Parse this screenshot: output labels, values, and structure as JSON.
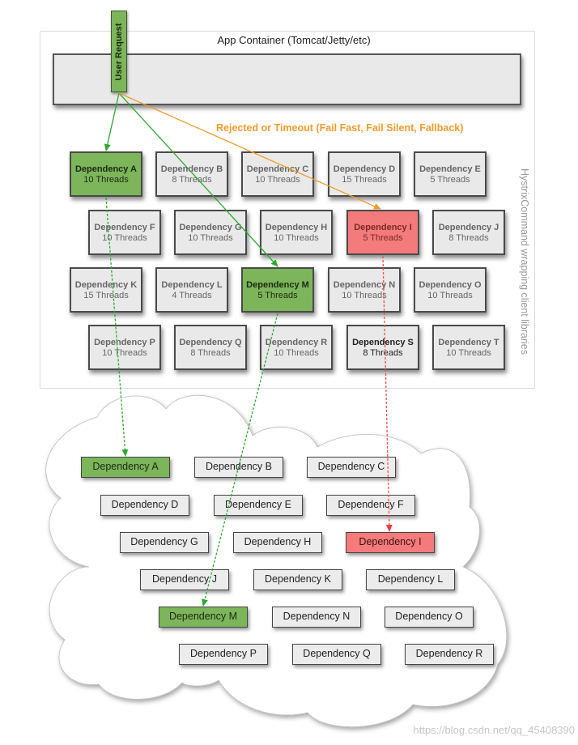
{
  "container": {
    "title": "App Container (Tomcat/Jetty/etc)",
    "side_label": "HystrixCommand wrapping client libraries"
  },
  "user_request": {
    "label": "User Request",
    "color": "#7cb55a"
  },
  "reject_label": {
    "text": "Rejected or Timeout (Fail Fast, Fail Silent, Fallback)",
    "color": "#f39b2b"
  },
  "colors": {
    "success": "#7cb55a",
    "failure": "#f47b7b",
    "neutral": "#e9e9e9",
    "success_arrow": "#2ea82e",
    "failure_arrow": "#f39b2b",
    "failure_dotted": "#f05050"
  },
  "command_rows": [
    [
      {
        "name": "Dependency A",
        "threads": "10 Threads",
        "state": "success"
      },
      {
        "name": "Dependency B",
        "threads": "8 Threads",
        "state": "normal"
      },
      {
        "name": "Dependency C",
        "threads": "10 Threads",
        "state": "normal"
      },
      {
        "name": "Dependency D",
        "threads": "15 Threads",
        "state": "normal"
      },
      {
        "name": "Dependency E",
        "threads": "5 Threads",
        "state": "normal"
      }
    ],
    [
      {
        "name": "Dependency F",
        "threads": "10 Threads",
        "state": "normal"
      },
      {
        "name": "Dependency G",
        "threads": "10 Threads",
        "state": "normal"
      },
      {
        "name": "Dependency H",
        "threads": "10 Threads",
        "state": "normal"
      },
      {
        "name": "Dependency I",
        "threads": "5 Threads",
        "state": "failure"
      },
      {
        "name": "Dependency J",
        "threads": "8 Threads",
        "state": "normal"
      }
    ],
    [
      {
        "name": "Dependency K",
        "threads": "15 Threads",
        "state": "normal"
      },
      {
        "name": "Dependency L",
        "threads": "4 Threads",
        "state": "normal"
      },
      {
        "name": "Dependency M",
        "threads": "5 Threads",
        "state": "success"
      },
      {
        "name": "Dependency N",
        "threads": "10 Threads",
        "state": "normal"
      },
      {
        "name": "Dependency O",
        "threads": "10 Threads",
        "state": "normal"
      }
    ],
    [
      {
        "name": "Dependency P",
        "threads": "10 Threads",
        "state": "normal"
      },
      {
        "name": "Dependency Q",
        "threads": "8 Threads",
        "state": "normal"
      },
      {
        "name": "Dependency R",
        "threads": "10 Threads",
        "state": "normal"
      },
      {
        "name": "Dependency S",
        "threads": "8 Threads",
        "state": "bold"
      },
      {
        "name": "Dependency T",
        "threads": "10 Threads",
        "state": "normal"
      }
    ]
  ],
  "cloud_rows": [
    [
      {
        "name": "Dependency A",
        "state": "success"
      },
      {
        "name": "Dependency B",
        "state": "normal"
      },
      {
        "name": "Dependency C",
        "state": "normal"
      }
    ],
    [
      {
        "name": "Dependency D",
        "state": "normal"
      },
      {
        "name": "Dependency E",
        "state": "normal"
      },
      {
        "name": "Dependency F",
        "state": "normal"
      }
    ],
    [
      {
        "name": "Dependency G",
        "state": "normal"
      },
      {
        "name": "Dependency H",
        "state": "normal"
      },
      {
        "name": "Dependency I",
        "state": "failure"
      }
    ],
    [
      {
        "name": "Dependency J",
        "state": "normal"
      },
      {
        "name": "Dependency K",
        "state": "normal"
      },
      {
        "name": "Dependency L",
        "state": "normal"
      }
    ],
    [
      {
        "name": "Dependency M",
        "state": "success"
      },
      {
        "name": "Dependency N",
        "state": "normal"
      },
      {
        "name": "Dependency O",
        "state": "normal"
      }
    ],
    [
      {
        "name": "Dependency P",
        "state": "normal"
      },
      {
        "name": "Dependency Q",
        "state": "normal"
      },
      {
        "name": "Dependency R",
        "state": "normal"
      }
    ]
  ],
  "flows": [
    {
      "from": "User Request",
      "to": "Dependency A",
      "type": "success"
    },
    {
      "from": "User Request",
      "to": "Dependency M",
      "type": "success"
    },
    {
      "from": "User Request",
      "to": "Dependency I",
      "type": "rejected"
    },
    {
      "from": "Dependency A",
      "to": "Dependency A (remote)",
      "type": "success-call"
    },
    {
      "from": "Dependency M",
      "to": "Dependency M (remote)",
      "type": "success-call"
    },
    {
      "from": "Dependency I",
      "to": "Dependency I (remote)",
      "type": "failure-call"
    }
  ],
  "watermark": "https://blog.csdn.net/qq_45408390"
}
